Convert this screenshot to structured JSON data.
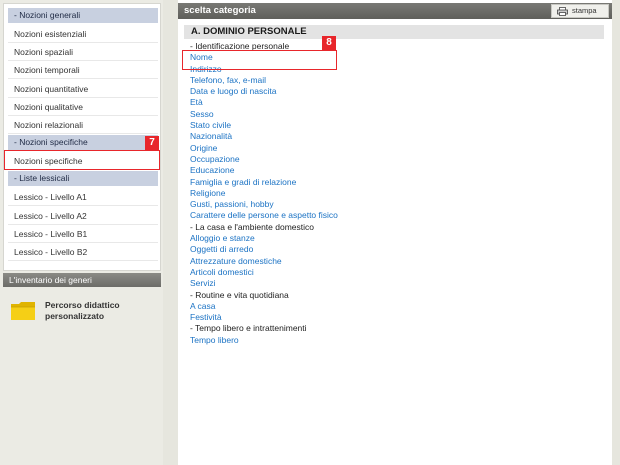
{
  "sidebar": {
    "sections": [
      {
        "header": "- Nozioni generali",
        "items": [
          "Nozioni esistenziali",
          "Nozioni spaziali",
          "Nozioni temporali",
          "Nozioni quantitative",
          "Nozioni qualitative",
          "Nozioni relazionali"
        ]
      },
      {
        "header": "- Nozioni specifiche",
        "items": [
          "Nozioni specifiche"
        ]
      },
      {
        "header": "- Liste lessicali",
        "items": [
          "Lessico - Livello A1",
          "Lessico - Livello A2",
          "Lessico - Livello B1",
          "Lessico - Livello B2"
        ]
      }
    ],
    "bottom_bar": "L'inventario dei generi",
    "percorso": {
      "line1": "Percorso didattico",
      "line2": "personalizzato",
      "icon": "folder-icon"
    }
  },
  "main": {
    "title": "scelta categoria",
    "stampa_label": "stampa",
    "section_title": "A. DOMINIO PERSONALE",
    "categories": [
      {
        "label": "- Identificazione personale",
        "type": "head"
      },
      {
        "label": "Nome",
        "type": "link"
      },
      {
        "label": "Indirizzo",
        "type": "link"
      },
      {
        "label": "Telefono, fax, e-mail",
        "type": "link"
      },
      {
        "label": "Data e luogo di nascita",
        "type": "link"
      },
      {
        "label": "Età",
        "type": "link"
      },
      {
        "label": "Sesso",
        "type": "link"
      },
      {
        "label": "Stato civile",
        "type": "link"
      },
      {
        "label": "Nazionalità",
        "type": "link"
      },
      {
        "label": "Origine",
        "type": "link"
      },
      {
        "label": "Occupazione",
        "type": "link"
      },
      {
        "label": "Educazione",
        "type": "link"
      },
      {
        "label": "Famiglia e gradi di relazione",
        "type": "link"
      },
      {
        "label": "Religione",
        "type": "link"
      },
      {
        "label": "Gusti, passioni, hobby",
        "type": "link"
      },
      {
        "label": "Carattere delle persone e aspetto fisico",
        "type": "link"
      },
      {
        "label": "- La casa e l'ambiente domestico",
        "type": "head"
      },
      {
        "label": "Alloggio e stanze",
        "type": "link"
      },
      {
        "label": "Oggetti di arredo",
        "type": "link"
      },
      {
        "label": "Attrezzature domestiche",
        "type": "link"
      },
      {
        "label": "Articoli domestici",
        "type": "link"
      },
      {
        "label": "Servizi",
        "type": "link"
      },
      {
        "label": "- Routine e vita quotidiana",
        "type": "head"
      },
      {
        "label": "A casa",
        "type": "link"
      },
      {
        "label": "Festività",
        "type": "link"
      },
      {
        "label": "- Tempo libero e intrattenimenti",
        "type": "head"
      },
      {
        "label": "Tempo libero",
        "type": "link"
      }
    ]
  },
  "annotations": {
    "badge_7": "7",
    "badge_8": "8",
    "color": "#e8262b"
  },
  "colors": {
    "link": "#1c73c4",
    "header_bar": "#c8d0e0",
    "title_bar": "#6c6c68"
  }
}
